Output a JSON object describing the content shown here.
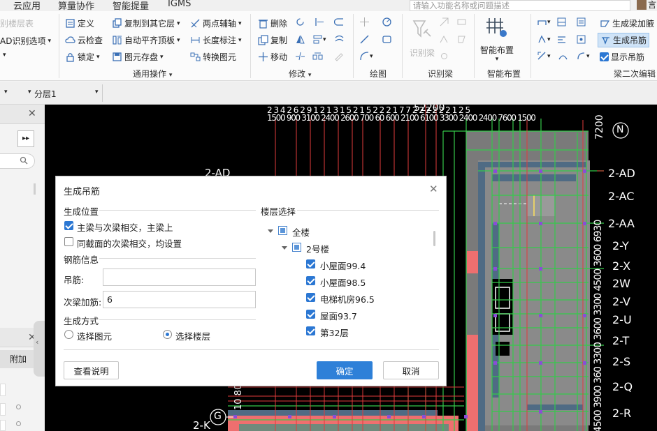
{
  "menubar": {
    "items": [
      "云应用",
      "算量协作",
      "智能提量",
      "IGMS"
    ],
    "search_placeholder": "请输入功能名称或问题描述",
    "user_name": "言"
  },
  "ribbon": {
    "left_items": [
      "别楼层表",
      "AD识别选项"
    ],
    "general_ops": {
      "items": [
        "定义",
        "复制到其它层",
        "两点辅轴",
        "云检查",
        "自动平齐顶板",
        "长度标注",
        "锁定",
        "图元存盘",
        "转换图元"
      ],
      "group_label": "通用操作"
    },
    "modify": {
      "items": [
        "删除",
        "复制",
        "移动"
      ],
      "group_label": "修改"
    },
    "draw": {
      "group_label": "绘图"
    },
    "identify_beam": {
      "button": "识别梁",
      "group_label": "识别梁"
    },
    "smart_layout": {
      "button": "智能布置",
      "group_label": "智能布置"
    },
    "secondary_beam_edit": {
      "items": [
        "生成梁加腋",
        "生成吊筋",
        "显示吊筋"
      ],
      "group_label": "梁二次编辑"
    }
  },
  "layerbar": {
    "layer_value": "分层1"
  },
  "canvas": {
    "top_labels_row1": "2 3 4 2 6    2 9 1 2 1 3 1 5 2 1 5    2 2    2 1 7 7 2 2 2 2 2    2 1 2 5",
    "top_labels_row2": "1500 900 3100 2400 2600 700 60 600 2100   6100 3300 2400 2400 7600 1500",
    "top_number": "52200",
    "left_labels": [
      "2-AD",
      "2-K",
      "G"
    ],
    "right_axis_labels": [
      "N",
      "2-AD",
      "2-AC",
      "2-AA",
      "2-Y",
      "2-X",
      "2W",
      "2-V",
      "2-U",
      "2-T",
      "2-S",
      "2-Q",
      "2-R"
    ],
    "right_dim_top": "7200",
    "right_dim_text": "4500  3900  360  3300  3600  3300  4500  3600  6930",
    "bottom_dim": "10 800"
  },
  "leftpanel": {
    "tab_label": "附加"
  },
  "dialog": {
    "title": "生成吊筋",
    "position_section": "生成位置",
    "options": [
      {
        "label": "主梁与次梁相交，主梁上",
        "checked": true
      },
      {
        "label": "同截面的次梁相交，均设置",
        "checked": false
      }
    ],
    "rebar_section": "钢筋信息",
    "hanging_bar_label": "吊筋:",
    "hanging_bar_value": "",
    "secondary_bar_label": "次梁加筋:",
    "secondary_bar_value": "6",
    "method_section": "生成方式",
    "methods": [
      {
        "label": "选择图元",
        "selected": false
      },
      {
        "label": "选择楼层",
        "selected": true
      }
    ],
    "floor_section": "楼层选择",
    "tree": {
      "root": "全楼",
      "building": "2号楼",
      "floors": [
        "小屋面99.4",
        "小屋面98.5",
        "电梯机房96.5",
        "屋面93.7",
        "第32层"
      ]
    },
    "help_button": "查看说明",
    "ok_button": "确定",
    "cancel_button": "取消"
  }
}
